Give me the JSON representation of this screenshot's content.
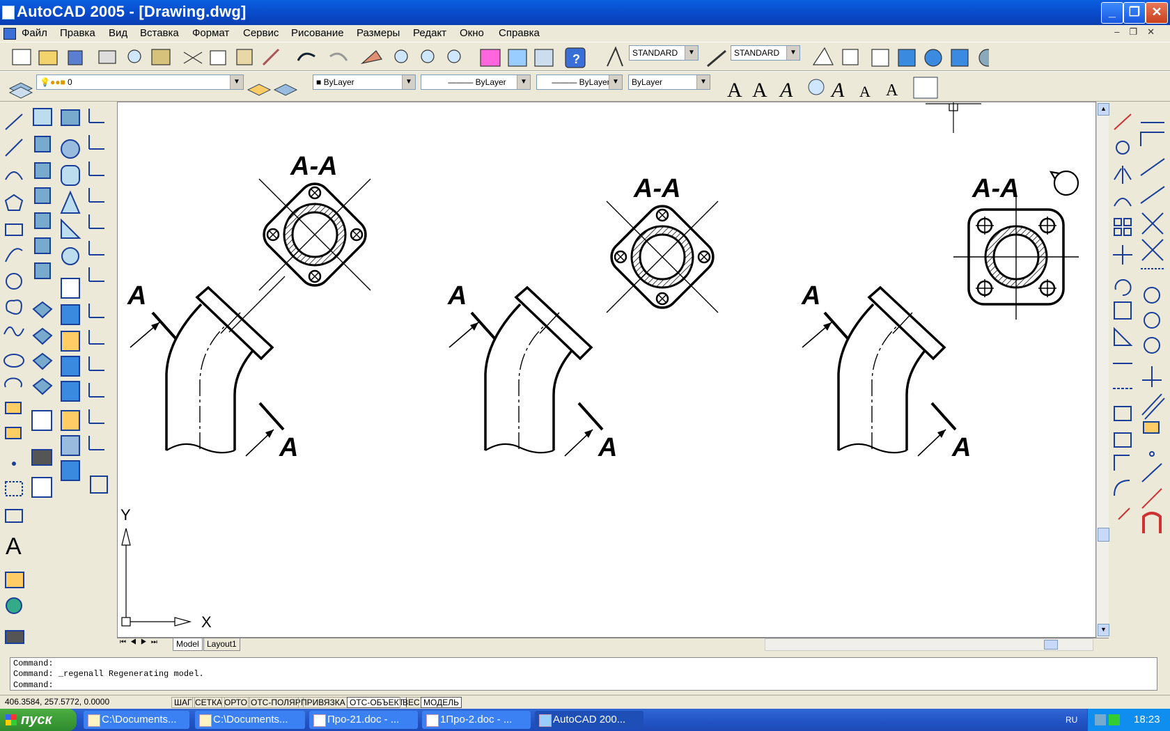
{
  "window": {
    "title": "AutoCAD 2005 - [Drawing.dwg]"
  },
  "menu": [
    "Файл",
    "Правка",
    "Вид",
    "Вставка",
    "Формат",
    "Сервис",
    "Рисование",
    "Размеры",
    "Редакт",
    "Окно",
    "Справка"
  ],
  "toolbar": {
    "text_style": "STANDARD",
    "dim_style": "STANDARD",
    "layer": "0",
    "color": "ByLayer",
    "linetype": "ByLayer",
    "lineweight": "ByLayer",
    "plotstyle": "ByLayer"
  },
  "drawing": {
    "section_label": "А-А",
    "cut_label": "А",
    "axis_x": "X",
    "axis_y": "Y"
  },
  "tabs": {
    "model": "Model",
    "layout": "Layout1"
  },
  "command": {
    "line1": "Command:",
    "line2": "Command: _regenall Regenerating model.",
    "line3": "Command:"
  },
  "status": {
    "coords": "406.3584, 257.5772, 0.0000",
    "buttons": [
      "ШАГ",
      "СЕТКА",
      "ОРТО",
      "ОТС-ПОЛЯР",
      "ПРИВЯЗКА",
      "ОТС-ОБЪЕКТ",
      "ВЕС",
      "МОДЕЛЬ"
    ]
  },
  "taskbar": {
    "start": "пуск",
    "items": [
      "C:\\Documents...",
      "C:\\Documents...",
      "Про-21.doc - ...",
      "1Про-2.doc - ...",
      "AutoCAD 200..."
    ],
    "lang": "RU",
    "clock": "18:23"
  }
}
